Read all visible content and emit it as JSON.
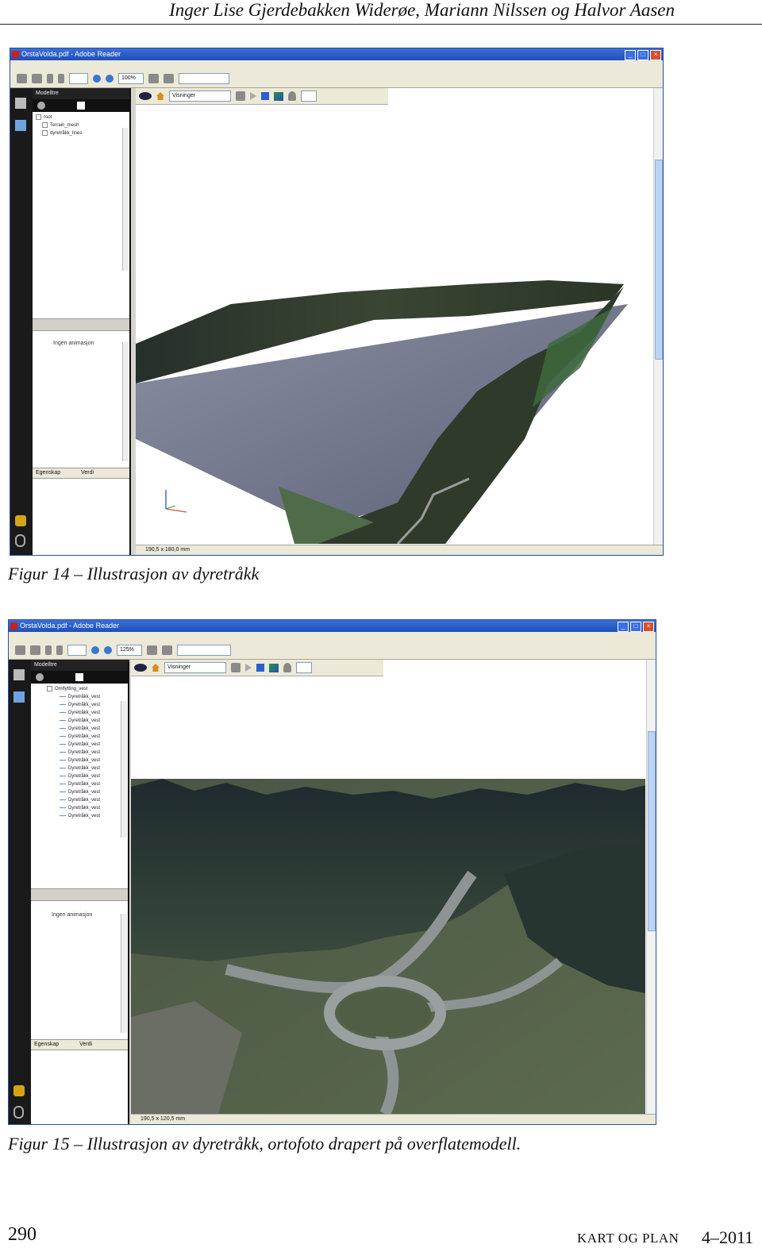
{
  "header": {
    "authors": "Inger Lise Gjerdebakken Widerøe, Mariann Nilssen og Halvor Aasen"
  },
  "figures": [
    {
      "caption": "Figur 14 – Illustrasjon av dyretråkk",
      "window": {
        "title": "OrstaVolda.pdf - Adobe Reader",
        "zoom": "100%",
        "panel_title": "Modelltre",
        "tree_items": [
          "root",
          "Terrain_mesh",
          "dyretråkk_lines"
        ],
        "sub_panel_label": "Ingen animasjon",
        "property_headers": [
          "Egenskap",
          "Verdi"
        ],
        "view_select": "Visninger",
        "status": "190,5 x 180,0 mm"
      }
    },
    {
      "caption": "Figur 15 – Illustrasjon av dyretråkk, ortofoto drapert på overflatemodell.",
      "window": {
        "title": "OrstaVolda.pdf - Adobe Reader",
        "zoom": "125%",
        "panel_title": "Modelltre",
        "tree_items": [
          "Omflytting_vest",
          "Dyretråkk_vest",
          "Dyretråkk_vest",
          "Dyretråkk_vest",
          "Dyretråkk_vest",
          "Dyretråkk_vest",
          "Dyretråkk_vest",
          "Dyretråkk_vest",
          "Dyretråkk_vest",
          "Dyretråkk_vest",
          "Dyretråkk_vest",
          "Dyretråkk_vest",
          "Dyretråkk_vest",
          "Dyretråkk_vest",
          "Dyretråkk_vest",
          "Dyretråkk_vest",
          "Dyretråkk_vest"
        ],
        "sub_panel_label": "Ingen animasjon",
        "property_headers": [
          "Egenskap",
          "Verdi"
        ],
        "view_select": "Visninger",
        "status": "190,5 x 120,5 mm"
      }
    }
  ],
  "footer": {
    "page_number": "290",
    "journal": "KART OG PLAN",
    "issue": "4–2011"
  },
  "icons": [
    "print-icon",
    "home-icon",
    "eye-icon",
    "cube-icon",
    "light-icon",
    "comment-icon",
    "attachment-icon"
  ]
}
